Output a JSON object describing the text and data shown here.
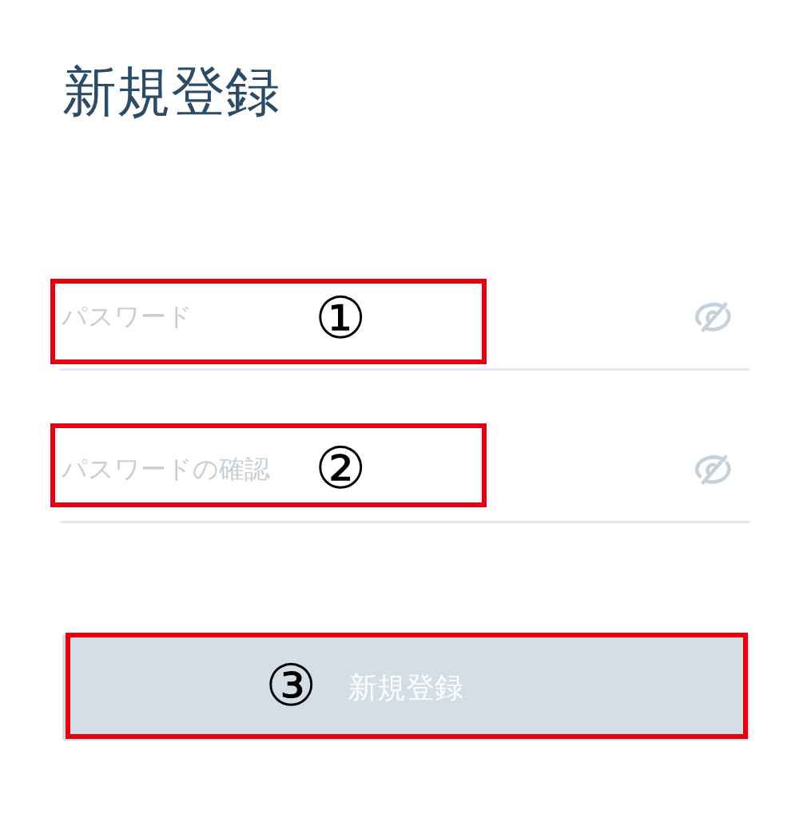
{
  "title": "新規登録",
  "fields": [
    {
      "placeholder": "パスワード",
      "annotation": "①"
    },
    {
      "placeholder": "パスワードの確認",
      "annotation": "②"
    }
  ],
  "submit_button": {
    "label": "新規登録",
    "disabled": true,
    "annotation": "③"
  }
}
